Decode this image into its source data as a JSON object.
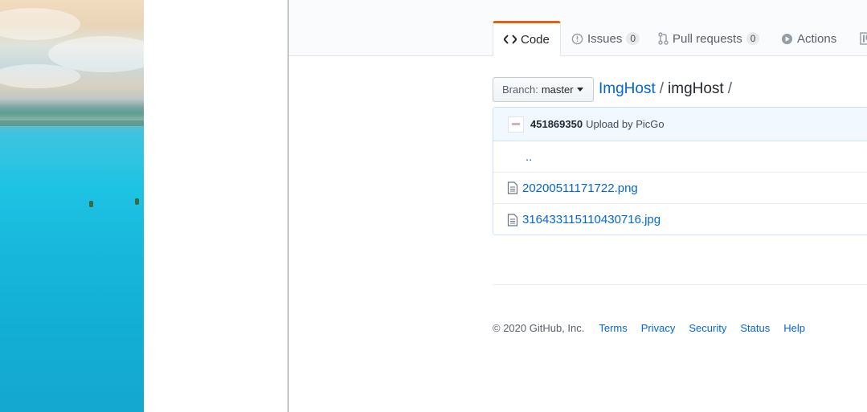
{
  "nav": {
    "tabs": [
      {
        "label": "Code",
        "icon": "code-icon"
      },
      {
        "label": "Issues",
        "icon": "issue-opened-icon",
        "count": "0"
      },
      {
        "label": "Pull requests",
        "icon": "git-pull-request-icon",
        "count": "0"
      },
      {
        "label": "Actions",
        "icon": "play-icon"
      },
      {
        "label": "",
        "icon": "project-icon"
      }
    ],
    "selected_color": "#e36209"
  },
  "branch": {
    "label": "Branch:",
    "name": "master"
  },
  "breadcrumb": {
    "repo": "ImgHost",
    "sep1": "/",
    "dir": "imgHost",
    "sep2": "/"
  },
  "commit": {
    "sha": "451869350",
    "message": "Upload by PicGo"
  },
  "files": {
    "updir": "..",
    "items": [
      {
        "name": "20200511171722.png",
        "icon": "file-icon"
      },
      {
        "name": "316433115110430716.jpg",
        "icon": "file-icon"
      }
    ]
  },
  "footer": {
    "copyright": "© 2020 GitHub, Inc.",
    "links": [
      "Terms",
      "Privacy",
      "Security",
      "Status",
      "Help"
    ]
  },
  "colors": {
    "link": "#0366d6",
    "accent": "#e36209"
  }
}
